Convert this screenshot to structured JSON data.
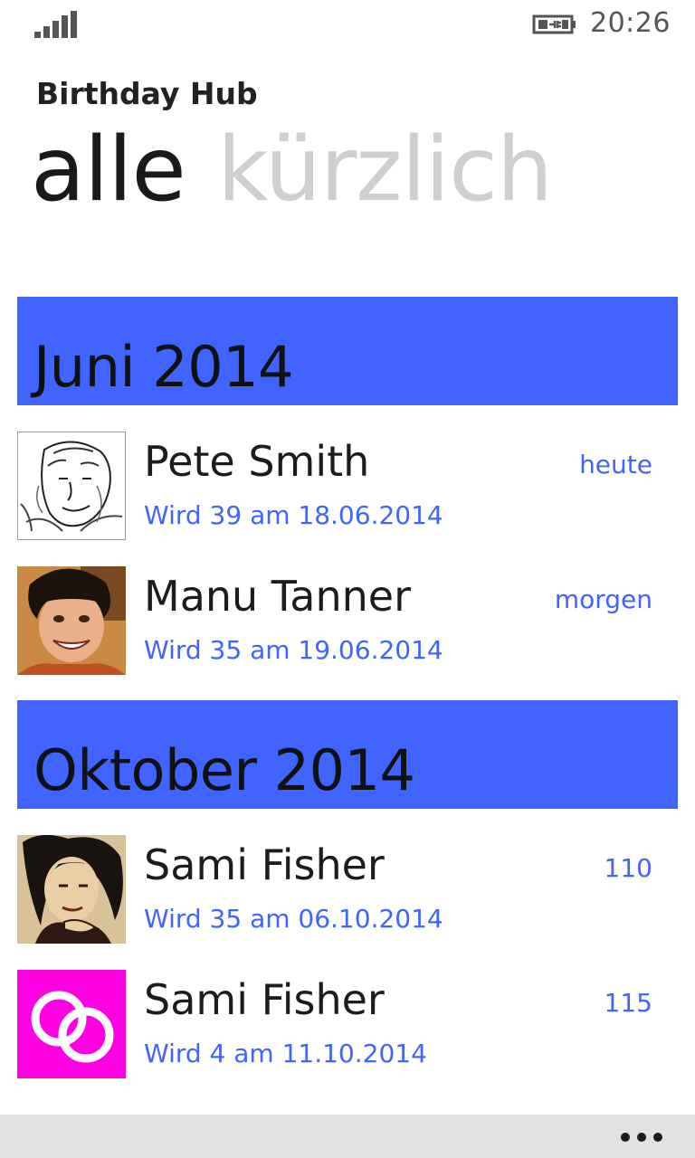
{
  "status_bar": {
    "time": "20:26",
    "signal_icon": "signal-strength-icon",
    "battery_icon": "battery-charging-icon"
  },
  "app": {
    "title": "Birthday Hub"
  },
  "pivot": {
    "active": "alle",
    "inactive": "kürzlich"
  },
  "colors": {
    "accent": "#4163ff",
    "magenta_tile": "#ff00e0"
  },
  "groups": [
    {
      "header": "Juni 2014",
      "items": [
        {
          "name": "Pete Smith",
          "detail": "Wird 39 am 18.06.2014",
          "when": "heute",
          "avatar": "photo-sketch-man"
        },
        {
          "name": "Manu Tanner",
          "detail": "Wird 35 am 19.06.2014",
          "when": "morgen",
          "avatar": "photo-woman-smiling"
        }
      ]
    },
    {
      "header": "Oktober 2014",
      "items": [
        {
          "name": "Sami Fisher",
          "detail": "Wird 35 am 06.10.2014",
          "when": "110",
          "avatar": "photo-woman-curly-hair"
        },
        {
          "name": "Sami Fisher",
          "detail": "Wird 4 am 11.10.2014",
          "when": "115",
          "avatar": "wedding-rings-icon"
        }
      ]
    }
  ],
  "app_bar": {
    "more_icon": "more-ellipsis-icon"
  }
}
